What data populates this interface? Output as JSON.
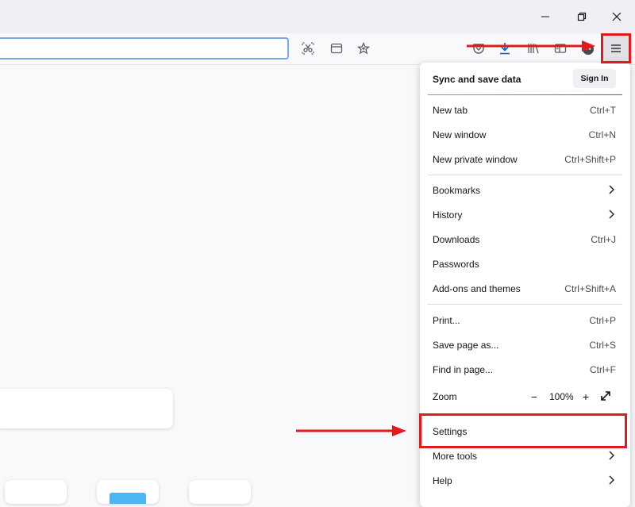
{
  "window_controls": {
    "minimize_icon": "minimize-icon",
    "restore_icon": "restore-icon",
    "close_icon": "close-icon"
  },
  "toolbar": {
    "url_value": "",
    "icons": [
      "screenshot-icon",
      "reader-view-icon",
      "bookmark-star-icon",
      "pocket-icon",
      "downloads-icon",
      "library-icon",
      "sidebar-icon",
      "extension-icon",
      "hamburger-menu-icon"
    ]
  },
  "colors": {
    "annotation_red": "#e01b1b",
    "download_blue": "#0060df",
    "accent_gradient": [
      "#ff6f4e",
      "#c050ff",
      "#7542e5"
    ]
  },
  "menu": {
    "sync": {
      "label": "Sync and save data",
      "button": "Sign In"
    },
    "items": [
      {
        "label": "New tab",
        "shortcut": "Ctrl+T"
      },
      {
        "label": "New window",
        "shortcut": "Ctrl+N"
      },
      {
        "label": "New private window",
        "shortcut": "Ctrl+Shift+P"
      },
      {
        "label": "Bookmarks",
        "shortcut": ""
      },
      {
        "label": "History",
        "shortcut": ""
      },
      {
        "label": "Downloads",
        "shortcut": "Ctrl+J"
      },
      {
        "label": "Passwords",
        "shortcut": ""
      },
      {
        "label": "Add-ons and themes",
        "shortcut": "Ctrl+Shift+A"
      },
      {
        "label": "Print...",
        "shortcut": "Ctrl+P"
      },
      {
        "label": "Save page as...",
        "shortcut": "Ctrl+S"
      },
      {
        "label": "Find in page...",
        "shortcut": "Ctrl+F"
      },
      {
        "label": "Zoom",
        "shortcut": ""
      },
      {
        "label": "Settings",
        "shortcut": ""
      },
      {
        "label": "More tools",
        "shortcut": ""
      },
      {
        "label": "Help",
        "shortcut": ""
      }
    ],
    "zoom": {
      "minus": "−",
      "value": "100%",
      "plus": "+"
    }
  }
}
